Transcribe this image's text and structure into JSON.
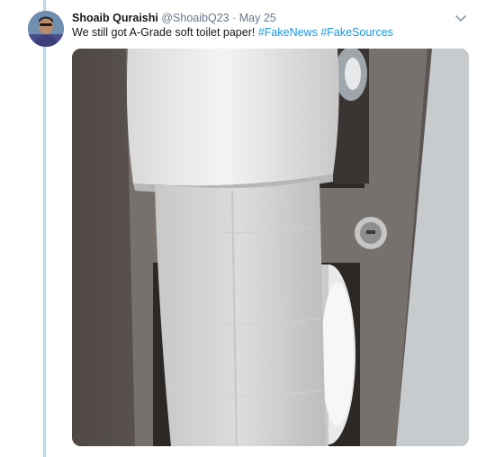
{
  "tweet": {
    "author_name": "Shoaib Quraishi",
    "handle": "@ShoaibQ23",
    "separator": "·",
    "date": "May 25",
    "text": "We still got A-Grade soft toilet paper!",
    "hashtags": [
      "#FakeNews",
      "#FakeSources"
    ]
  },
  "icons": {
    "caret": "chevron-down-icon",
    "avatar": "avatar-photo"
  },
  "colors": {
    "hashtag": "#1b95e0",
    "meta_text": "#657786",
    "thread_line": "#b9d7ee"
  }
}
